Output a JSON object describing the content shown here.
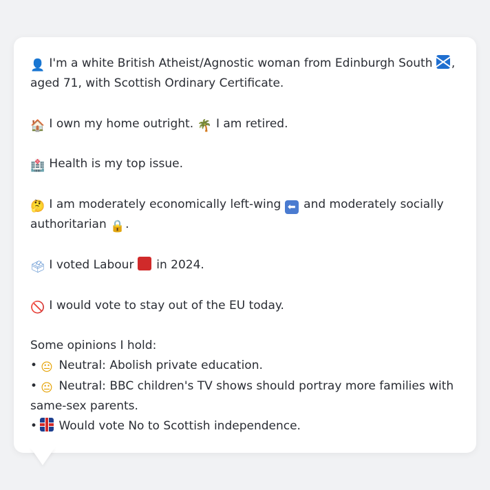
{
  "profile": {
    "intro": "I'm a white British Atheist/Agnostic woman from Edinburgh South",
    "intro_tail": ",",
    "intro_line2": "aged 71, with Scottish Ordinary Certificate.",
    "home": "I own my home outright.",
    "retired": "I am retired.",
    "health": "Health is my top issue.",
    "politics_1": "I am moderately economically left-wing",
    "politics_2": "and moderately socially",
    "politics_3": "authoritarian",
    "politics_end": ".",
    "vote_1": "I voted Labour",
    "vote_2": "in 2024.",
    "eu": "I would vote to stay out of the EU today.",
    "opinions_heading": "Some opinions I hold:",
    "opinions": [
      {
        "bullet": "•",
        "text": "Neutral: Abolish private education.",
        "icon": "neutral-face-icon"
      },
      {
        "bullet": "•",
        "text": "Neutral: BBC children's TV shows should portray more families with",
        "text2": "same-sex parents.",
        "icon": "neutral-face-icon"
      },
      {
        "bullet": "•",
        "text": "Would vote No to Scottish independence.",
        "icon": "uk-flag-icon"
      }
    ]
  },
  "icons": {
    "bust": "👤",
    "house": "🏠",
    "palm": "🌴",
    "hospital": "🏥",
    "thinking": "🤔",
    "left_arrow": "⬅",
    "lock": "🔒",
    "ballot": "🗳",
    "no_entry": "🚫",
    "neutral": "😐"
  },
  "colors": {
    "background": "#f1f2f4",
    "card": "#ffffff",
    "text": "#2a2d34"
  }
}
